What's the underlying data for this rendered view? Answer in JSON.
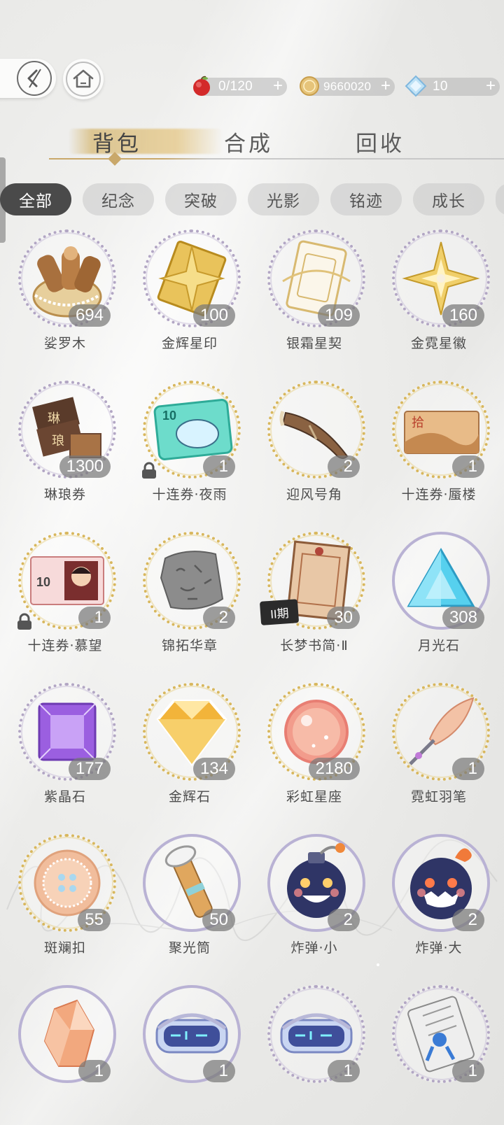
{
  "currencies": [
    {
      "icon": "red-apple-icon",
      "value": "0/120",
      "plus": "+"
    },
    {
      "icon": "gold-coin-icon",
      "value": "9660020",
      "plus": "+"
    },
    {
      "icon": "blue-crystal-icon",
      "value": "10",
      "plus": "+"
    }
  ],
  "main_tabs": [
    {
      "label": "背包",
      "active": true
    },
    {
      "label": "合成",
      "active": false
    },
    {
      "label": "回收",
      "active": false
    }
  ],
  "filters": [
    {
      "label": "全部",
      "active": true
    },
    {
      "label": "纪念",
      "active": false
    },
    {
      "label": "突破",
      "active": false
    },
    {
      "label": "光影",
      "active": false
    },
    {
      "label": "铭迹",
      "active": false
    },
    {
      "label": "成长",
      "active": false
    }
  ],
  "items": [
    {
      "name": "娑罗木",
      "count": "694",
      "icon": "wood-basket-icon",
      "ring": "silver"
    },
    {
      "name": "金辉星印",
      "count": "100",
      "icon": "gold-star-seal-icon",
      "ring": "silver"
    },
    {
      "name": "银霜星契",
      "count": "109",
      "icon": "silver-card-icon",
      "ring": "silver"
    },
    {
      "name": "金霓星徽",
      "count": "160",
      "icon": "gold-star-badge-icon",
      "ring": "silver"
    },
    {
      "name": "琳琅券",
      "count": "1300",
      "icon": "coupon-box-icon",
      "ring": "silver"
    },
    {
      "name": "十连券·夜雨",
      "count": "1",
      "icon": "teal-ticket-icon",
      "ring": "gold",
      "locked": true
    },
    {
      "name": "迎风号角",
      "count": "2",
      "icon": "horn-icon",
      "ring": "gold"
    },
    {
      "name": "十连券·蜃楼",
      "count": "1",
      "icon": "desert-ticket-icon",
      "ring": "gold"
    },
    {
      "name": "十连券·慕望",
      "count": "1",
      "icon": "pink-ticket-icon",
      "ring": "gold",
      "locked": true
    },
    {
      "name": "锦拓华章",
      "count": "2",
      "icon": "stone-tablet-icon",
      "ring": "gold"
    },
    {
      "name": "长梦书简·Ⅱ",
      "count": "30",
      "icon": "letter-icon",
      "ring": "gold",
      "tag": "II期"
    },
    {
      "name": "月光石",
      "count": "308",
      "icon": "blue-gem-icon",
      "ring": "plain"
    },
    {
      "name": "紫晶石",
      "count": "177",
      "icon": "purple-gem-icon",
      "ring": "silver"
    },
    {
      "name": "金辉石",
      "count": "134",
      "icon": "gold-diamond-icon",
      "ring": "gold"
    },
    {
      "name": "彩虹星座",
      "count": "2180",
      "icon": "pink-orb-icon",
      "ring": "gold"
    },
    {
      "name": "霓虹羽笔",
      "count": "1",
      "icon": "quill-icon",
      "ring": "gold"
    },
    {
      "name": "斑斓扣",
      "count": "55",
      "icon": "button-icon",
      "ring": "gold"
    },
    {
      "name": "聚光筒",
      "count": "50",
      "icon": "flashlight-icon",
      "ring": "plain"
    },
    {
      "name": "炸弹·小",
      "count": "2",
      "icon": "bomb-small-icon",
      "ring": "plain"
    },
    {
      "name": "炸弹·大",
      "count": "2",
      "icon": "bomb-large-icon",
      "ring": "plain"
    },
    {
      "name": "",
      "count": "1",
      "icon": "orange-crystal-icon",
      "ring": "plain"
    },
    {
      "name": "",
      "count": "1",
      "icon": "vr-goggles-icon",
      "ring": "plain"
    },
    {
      "name": "",
      "count": "1",
      "icon": "vr-goggles-icon",
      "ring": "silver"
    },
    {
      "name": "",
      "count": "1",
      "icon": "certificate-scroll-icon",
      "ring": "silver"
    }
  ]
}
